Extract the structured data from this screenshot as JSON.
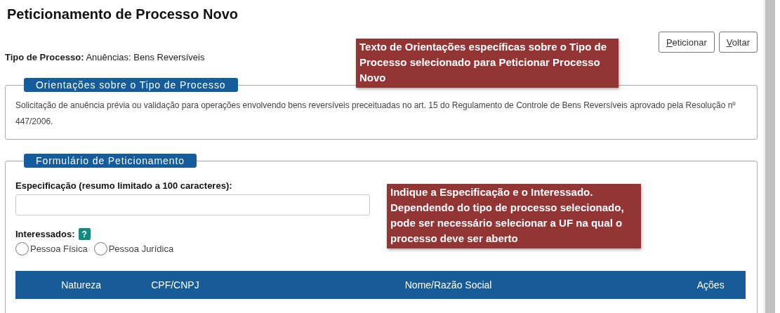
{
  "page_title": "Peticionamento de Processo Novo",
  "buttons": [
    {
      "label": "Peticionar",
      "key_underlined": true
    },
    {
      "label": "Voltar",
      "key_underlined": true
    }
  ],
  "process_type": {
    "label": "Tipo de Processo:",
    "value": "Anuências: Bens Reversíveis"
  },
  "guidance_section": {
    "legend": "Orientações sobre o Tipo de Processo",
    "text": "Solicitação de anuência prévia ou validação para operações envolvendo bens reversíveis preceituadas no art. 15 do Regulamento de Controle de Bens Reversíveis aprovado pela Resolução nº 447/2006."
  },
  "form_section": {
    "legend": "Formulário de Peticionamento",
    "specification_label": "Especificação (resumo limitado a 100 caracteres):",
    "interested_label": "Interessados:",
    "help_badge": "?",
    "radios": [
      {
        "label": "Pessoa Física",
        "selected": false
      },
      {
        "label": "Pessoa Jurídica",
        "selected": false
      }
    ],
    "table": {
      "columns": [
        "Natureza",
        "CPF/CNPJ",
        "Nome/Razão Social",
        "Ações"
      ]
    }
  },
  "callouts": [
    {
      "text": "Texto de Orientações específicas sobre o Tipo de Processo selecionado para Peticionar Processo Novo"
    },
    {
      "text": "Indique a Especificação e o Interessado. Dependendo do tipo de processo selecionado, pode ser necessário selecionar a UF na qual o processo deve ser aberto"
    }
  ]
}
